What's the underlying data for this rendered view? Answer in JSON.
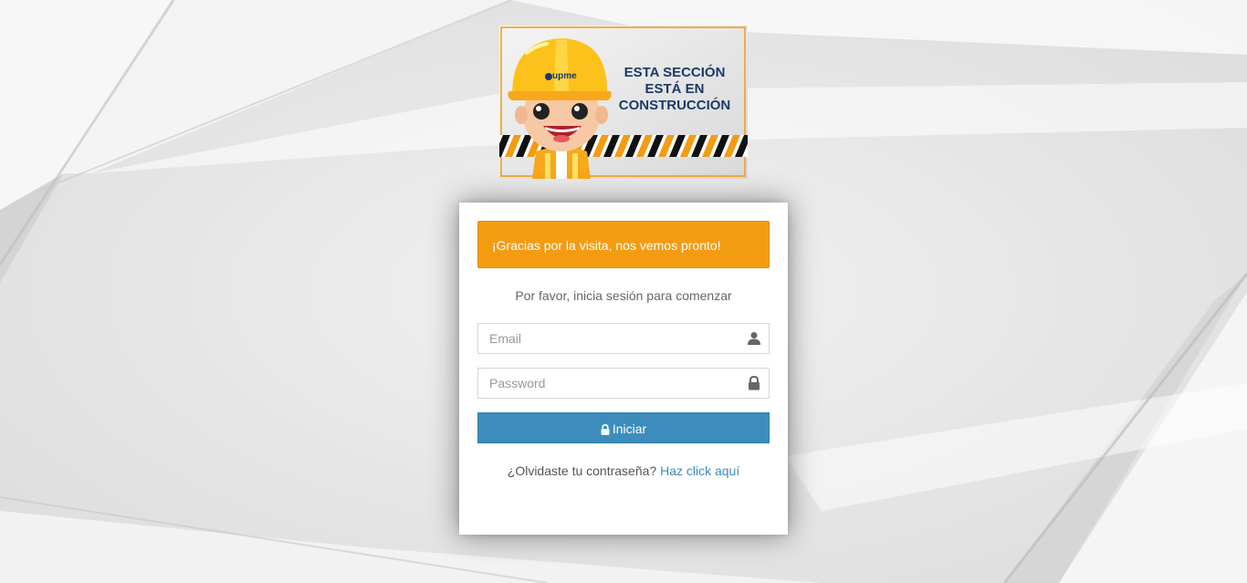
{
  "banner": {
    "line1": "ESTA SECCIÓN",
    "line2": "ESTÁ EN",
    "line3": "CONSTRUCCIÓN",
    "helmet_logo": "upme"
  },
  "alert": {
    "text": "¡Gracias por la visita, nos vemos pronto!",
    "color": "#f39c12"
  },
  "login": {
    "subtitle": "Por favor, inicia sesión para comenzar",
    "email_placeholder": "Email",
    "email_icon": "user-icon",
    "password_placeholder": "Password",
    "password_icon": "lock-icon",
    "submit_label": "Iniciar",
    "submit_color": "#3c8dbc",
    "forgot_text": "¿Olvidaste tu contraseña?",
    "forgot_link": "Haz click aquí"
  }
}
